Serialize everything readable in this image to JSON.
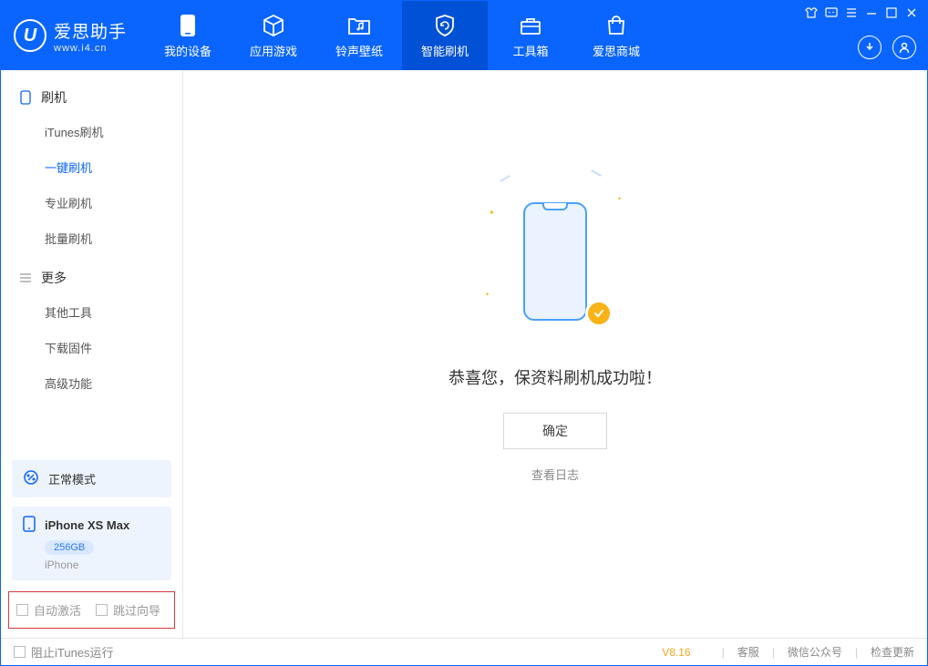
{
  "app": {
    "title": "爱思助手",
    "subtitle": "www.i4.cn"
  },
  "tabs": {
    "device": "我的设备",
    "apps": "应用游戏",
    "ringtone": "铃声壁纸",
    "flash": "智能刷机",
    "toolbox": "工具箱",
    "store": "爱思商城"
  },
  "sidebar": {
    "section_flash": "刷机",
    "items_flash": {
      "itunes": "iTunes刷机",
      "onekey": "一键刷机",
      "pro": "专业刷机",
      "batch": "批量刷机"
    },
    "section_more": "更多",
    "items_more": {
      "other": "其他工具",
      "firmware": "下载固件",
      "advanced": "高级功能"
    },
    "status": {
      "mode": "正常模式"
    },
    "device": {
      "name": "iPhone XS Max",
      "storage": "256GB",
      "type": "iPhone"
    },
    "checks": {
      "auto_activate": "自动激活",
      "skip_setup": "跳过向导"
    }
  },
  "main": {
    "success_text": "恭喜您，保资料刷机成功啦！",
    "ok_button": "确定",
    "view_log": "查看日志"
  },
  "footer": {
    "block_itunes": "阻止iTunes运行",
    "version": "V8.16",
    "support": "客服",
    "wechat": "微信公众号",
    "update": "检查更新"
  }
}
